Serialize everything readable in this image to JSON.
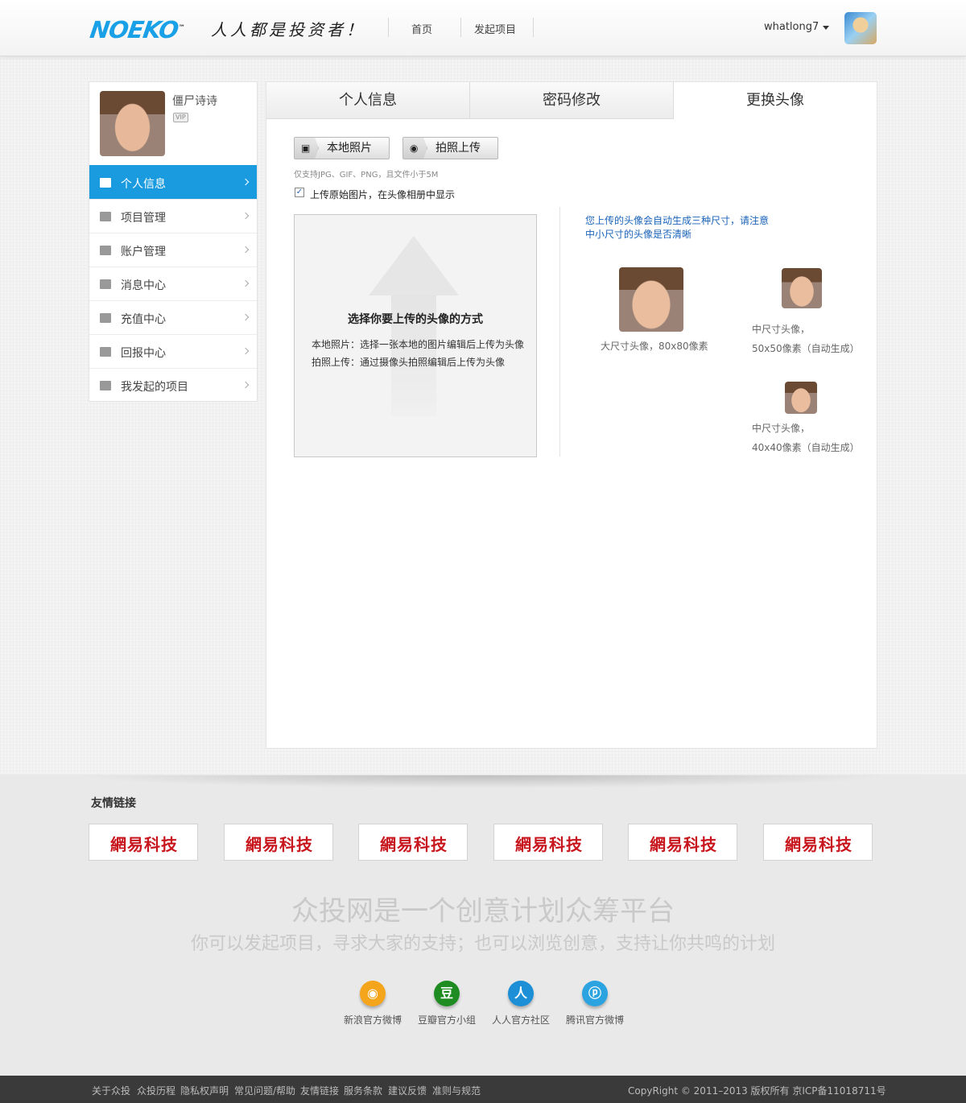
{
  "header": {
    "logo": "NOEKO",
    "logo_tm": "™",
    "slogan": "人人都是投资者！",
    "nav": [
      "首页",
      "发起项目"
    ],
    "username": "whatlong7"
  },
  "sidebar": {
    "profile_name": "僵尸诗诗",
    "badge": "VIP",
    "items": [
      {
        "label": "个人信息",
        "icon": "user-card-icon"
      },
      {
        "label": "项目管理",
        "icon": "list-grid-icon"
      },
      {
        "label": "账户管理",
        "icon": "account-book-icon"
      },
      {
        "label": "消息中心",
        "icon": "chat-bubble-icon"
      },
      {
        "label": "充值中心",
        "icon": "credit-card-icon"
      },
      {
        "label": "回报中心",
        "icon": "gift-icon"
      },
      {
        "label": "我发起的项目",
        "icon": "project-flag-icon"
      }
    ]
  },
  "tabs": [
    "个人信息",
    "密码修改",
    "更换头像"
  ],
  "avatar_upload": {
    "local_button": "本地照片",
    "camera_button": "拍照上传",
    "hint": "仅支持JPG、GIF、PNG，且文件小于5M",
    "checkbox_label": "上传原始图片，在头像相册中显示",
    "box_title": "选择你要上传的头像的方式",
    "box_line1": "本地照片：选择一张本地的图片编辑后上传为头像",
    "box_line2": "拍照上传：通过摄像头拍照编辑后上传为头像",
    "notice_line1": "您上传的头像会自动生成三种尺寸，请注意",
    "notice_line2": "中小尺寸的头像是否清晰",
    "large_caption": "大尺寸头像，80x80像素",
    "medium_caption_1": "中尺寸头像，",
    "medium_caption_2": "50x50像素（自动生成）",
    "small_caption_1": "中尺寸头像，",
    "small_caption_2": "40x40像素（自动生成）"
  },
  "footer": {
    "links_title": "友情链接",
    "partner_text": "網易科技",
    "tagline1": "众投网是一个创意计划众筹平台",
    "tagline2": "你可以发起项目，寻求大家的支持；也可以浏览创意，支持让你共鸣的计划",
    "social": [
      {
        "label": "新浪官方微博",
        "glyph": "◉",
        "color": "#f4a51c"
      },
      {
        "label": "豆瓣官方小组",
        "glyph": "豆",
        "color": "#1f8c22"
      },
      {
        "label": "人人官方社区",
        "glyph": "人",
        "color": "#1c8fd6"
      },
      {
        "label": "腾讯官方微博",
        "glyph": "ⓟ",
        "color": "#2aa3e0"
      }
    ],
    "bottom_links": [
      "关于众投",
      "众投历程",
      "隐私权声明",
      "常见问题/帮助",
      "友情链接",
      "服务条款",
      "建议反馈",
      "准则与规范"
    ],
    "copyright": "CopyRight © 2011–2013    版权所有  京ICP备11018711号"
  }
}
